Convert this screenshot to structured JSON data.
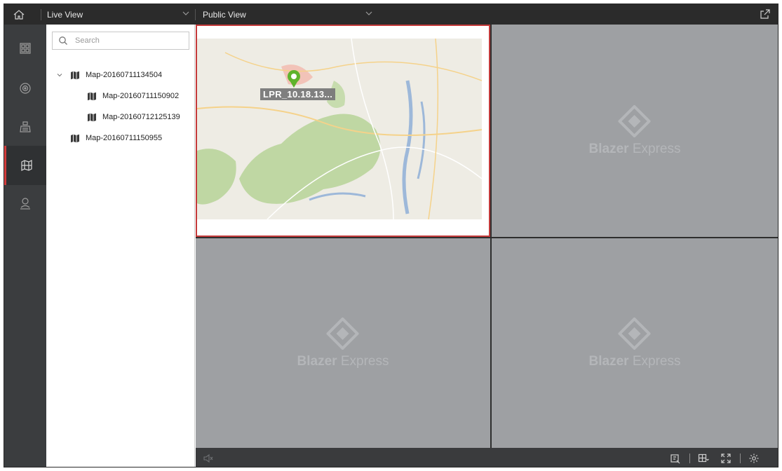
{
  "topbar": {
    "module_title": "Live View",
    "view_title": "Public View"
  },
  "rail": {
    "items": [
      "layout-icon",
      "camera-icon",
      "pos-icon",
      "map-icon",
      "person-icon"
    ],
    "active": "map-icon"
  },
  "tree": {
    "search_placeholder": "Search",
    "nodes": [
      {
        "label": "Map-20160711134504",
        "level": 0,
        "expanded": true
      },
      {
        "label": "Map-20160711150902",
        "level": 1
      },
      {
        "label": "Map-20160712125139",
        "level": 1
      },
      {
        "label": "Map-20160711150955",
        "level": 0
      }
    ]
  },
  "grid": {
    "camera_label": "LPR_10.18.13...",
    "placeholder_brand_bold": "Blazer",
    "placeholder_brand_light": " Express"
  },
  "colors": {
    "accent": "#c43a3a",
    "topbar": "#2b2b2b",
    "rail": "#3b3d3f",
    "pane": "#9ea0a3"
  }
}
